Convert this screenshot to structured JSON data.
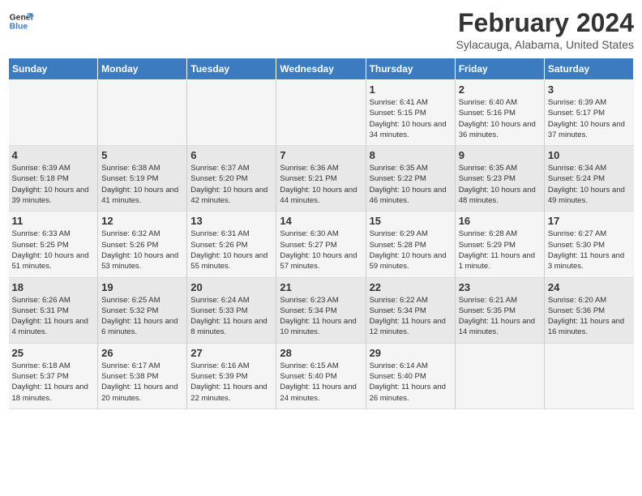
{
  "header": {
    "logo_line1": "General",
    "logo_line2": "Blue",
    "title": "February 2024",
    "subtitle": "Sylacauga, Alabama, United States"
  },
  "days_of_week": [
    "Sunday",
    "Monday",
    "Tuesday",
    "Wednesday",
    "Thursday",
    "Friday",
    "Saturday"
  ],
  "weeks": [
    [
      {
        "num": "",
        "info": ""
      },
      {
        "num": "",
        "info": ""
      },
      {
        "num": "",
        "info": ""
      },
      {
        "num": "",
        "info": ""
      },
      {
        "num": "1",
        "info": "Sunrise: 6:41 AM\nSunset: 5:15 PM\nDaylight: 10 hours\nand 34 minutes."
      },
      {
        "num": "2",
        "info": "Sunrise: 6:40 AM\nSunset: 5:16 PM\nDaylight: 10 hours\nand 36 minutes."
      },
      {
        "num": "3",
        "info": "Sunrise: 6:39 AM\nSunset: 5:17 PM\nDaylight: 10 hours\nand 37 minutes."
      }
    ],
    [
      {
        "num": "4",
        "info": "Sunrise: 6:39 AM\nSunset: 5:18 PM\nDaylight: 10 hours\nand 39 minutes."
      },
      {
        "num": "5",
        "info": "Sunrise: 6:38 AM\nSunset: 5:19 PM\nDaylight: 10 hours\nand 41 minutes."
      },
      {
        "num": "6",
        "info": "Sunrise: 6:37 AM\nSunset: 5:20 PM\nDaylight: 10 hours\nand 42 minutes."
      },
      {
        "num": "7",
        "info": "Sunrise: 6:36 AM\nSunset: 5:21 PM\nDaylight: 10 hours\nand 44 minutes."
      },
      {
        "num": "8",
        "info": "Sunrise: 6:35 AM\nSunset: 5:22 PM\nDaylight: 10 hours\nand 46 minutes."
      },
      {
        "num": "9",
        "info": "Sunrise: 6:35 AM\nSunset: 5:23 PM\nDaylight: 10 hours\nand 48 minutes."
      },
      {
        "num": "10",
        "info": "Sunrise: 6:34 AM\nSunset: 5:24 PM\nDaylight: 10 hours\nand 49 minutes."
      }
    ],
    [
      {
        "num": "11",
        "info": "Sunrise: 6:33 AM\nSunset: 5:25 PM\nDaylight: 10 hours\nand 51 minutes."
      },
      {
        "num": "12",
        "info": "Sunrise: 6:32 AM\nSunset: 5:26 PM\nDaylight: 10 hours\nand 53 minutes."
      },
      {
        "num": "13",
        "info": "Sunrise: 6:31 AM\nSunset: 5:26 PM\nDaylight: 10 hours\nand 55 minutes."
      },
      {
        "num": "14",
        "info": "Sunrise: 6:30 AM\nSunset: 5:27 PM\nDaylight: 10 hours\nand 57 minutes."
      },
      {
        "num": "15",
        "info": "Sunrise: 6:29 AM\nSunset: 5:28 PM\nDaylight: 10 hours\nand 59 minutes."
      },
      {
        "num": "16",
        "info": "Sunrise: 6:28 AM\nSunset: 5:29 PM\nDaylight: 11 hours\nand 1 minute."
      },
      {
        "num": "17",
        "info": "Sunrise: 6:27 AM\nSunset: 5:30 PM\nDaylight: 11 hours\nand 3 minutes."
      }
    ],
    [
      {
        "num": "18",
        "info": "Sunrise: 6:26 AM\nSunset: 5:31 PM\nDaylight: 11 hours\nand 4 minutes."
      },
      {
        "num": "19",
        "info": "Sunrise: 6:25 AM\nSunset: 5:32 PM\nDaylight: 11 hours\nand 6 minutes."
      },
      {
        "num": "20",
        "info": "Sunrise: 6:24 AM\nSunset: 5:33 PM\nDaylight: 11 hours\nand 8 minutes."
      },
      {
        "num": "21",
        "info": "Sunrise: 6:23 AM\nSunset: 5:34 PM\nDaylight: 11 hours\nand 10 minutes."
      },
      {
        "num": "22",
        "info": "Sunrise: 6:22 AM\nSunset: 5:34 PM\nDaylight: 11 hours\nand 12 minutes."
      },
      {
        "num": "23",
        "info": "Sunrise: 6:21 AM\nSunset: 5:35 PM\nDaylight: 11 hours\nand 14 minutes."
      },
      {
        "num": "24",
        "info": "Sunrise: 6:20 AM\nSunset: 5:36 PM\nDaylight: 11 hours\nand 16 minutes."
      }
    ],
    [
      {
        "num": "25",
        "info": "Sunrise: 6:18 AM\nSunset: 5:37 PM\nDaylight: 11 hours\nand 18 minutes."
      },
      {
        "num": "26",
        "info": "Sunrise: 6:17 AM\nSunset: 5:38 PM\nDaylight: 11 hours\nand 20 minutes."
      },
      {
        "num": "27",
        "info": "Sunrise: 6:16 AM\nSunset: 5:39 PM\nDaylight: 11 hours\nand 22 minutes."
      },
      {
        "num": "28",
        "info": "Sunrise: 6:15 AM\nSunset: 5:40 PM\nDaylight: 11 hours\nand 24 minutes."
      },
      {
        "num": "29",
        "info": "Sunrise: 6:14 AM\nSunset: 5:40 PM\nDaylight: 11 hours\nand 26 minutes."
      },
      {
        "num": "",
        "info": ""
      },
      {
        "num": "",
        "info": ""
      }
    ]
  ]
}
